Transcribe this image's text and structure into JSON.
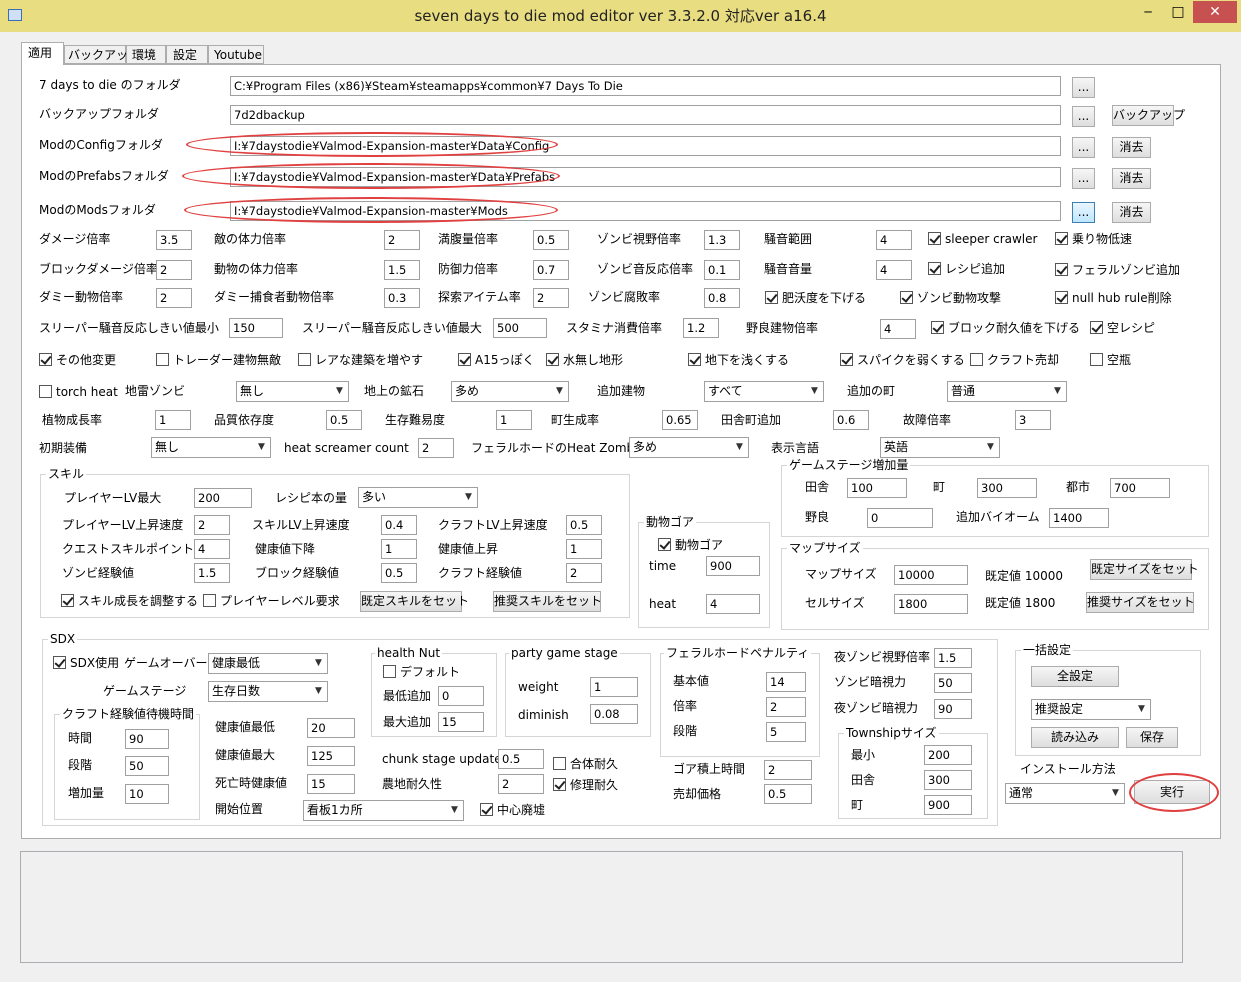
{
  "window": {
    "title": "seven days to die mod editor ver 3.3.2.0 対応ver a16.4",
    "minimize": "─",
    "maximize": "□",
    "close": "✕"
  },
  "tabs": [
    "適用",
    "バックアップ",
    "環境",
    "設定",
    "Youtube"
  ],
  "folders": {
    "game_label": "7 days to die のフォルダ",
    "game_value": "C:¥Program Files (x86)¥Steam¥steamapps¥common¥7 Days To Die",
    "backup_label": "バックアップフォルダ",
    "backup_value": "7d2dbackup",
    "config_label": "ModのConfigフォルダ",
    "config_value": "I:¥7daystodie¥Valmod-Expansion-master¥Data¥Config",
    "prefabs_label": "ModのPrefabsフォルダ",
    "prefabs_value": "I:¥7daystodie¥Valmod-Expansion-master¥Data¥Prefabs",
    "mods_label": "ModのModsフォルダ",
    "mods_value": "I:¥7daystodie¥Valmod-Expansion-master¥Mods",
    "browse": "...",
    "backup_btn": "バックアップ",
    "clear_btn": "消去"
  },
  "row1": {
    "l1": "ダメージ倍率",
    "v1": "3.5",
    "l2": "敵の体力倍率",
    "v2": "2",
    "l3": "満腹量倍率",
    "v3": "0.5",
    "l4": "ゾンビ視野倍率",
    "v4": "1.3",
    "l5": "騒音範囲",
    "v5": "4",
    "c1": "sleeper crawler",
    "c2": "乗り物低速"
  },
  "row2": {
    "l1": "ブロックダメージ倍率",
    "v1": "2",
    "l2": "動物の体力倍率",
    "v2": "1.5",
    "l3": "防御力倍率",
    "v3": "0.7",
    "l4": "ゾンビ音反応倍率",
    "v4": "0.1",
    "l5": "騒音音量",
    "v5": "4",
    "c1": "レシピ追加",
    "c2": "フェラルゾンビ追加"
  },
  "row3": {
    "l1": "ダミー動物倍率",
    "v1": "2",
    "l2": "ダミー捕食者動物倍率",
    "v2": "0.3",
    "l3": "探索アイテム率",
    "v3": "2",
    "l4": "ゾンビ腐敗率",
    "v4": "0.8",
    "c1": "肥沃度を下げる",
    "c2": "ゾンビ動物攻撃",
    "c3": "null hub rule削除"
  },
  "row4": {
    "l1": "スリーパー騒音反応しきい値最小",
    "v1": "150",
    "l2": "スリーパー騒音反応しきい値最大",
    "v2": "500",
    "l3": "スタミナ消費倍率",
    "v3": "1.2",
    "l4": "野良建物倍率",
    "v4": "4",
    "c1": "ブロック耐久値を下げる",
    "c2": "空レシピ"
  },
  "row5": {
    "c1": "その他変更",
    "c2": "トレーダー建物無敵",
    "c3": "レアな建築を増やす",
    "c4": "A15っぽく",
    "c5": "水無し地形",
    "c6": "地下を浅くする",
    "c7": "スパイクを弱くする",
    "c8": "クラフト売却",
    "c9": "空瓶"
  },
  "row6": {
    "c1": "torch heat",
    "l1": "地雷ゾンビ",
    "d1": "無し",
    "l2": "地上の鉱石",
    "d2": "多め",
    "l3": "追加建物",
    "d3": "すべて",
    "l4": "追加の町",
    "d4": "普通"
  },
  "row7": {
    "l1": "植物成長率",
    "v1": "1",
    "l2": "品質依存度",
    "v2": "0.5",
    "l3": "生存難易度",
    "v3": "1",
    "l4": "町生成率",
    "v4": "0.65",
    "l5": "田舎町追加",
    "v5": "0.6",
    "l6": "故障倍率",
    "v6": "3"
  },
  "row8": {
    "l1": "初期装備",
    "d1": "無し",
    "l2": "heat screamer count",
    "v2": "2",
    "l3": "フェラルホードのHeat Zombie量",
    "d3": "多め",
    "l4": "表示言語",
    "d4": "英語"
  },
  "skill": {
    "title": "スキル",
    "l1": "プレイヤーLV最大",
    "v1": "200",
    "l2": "レシピ本の量",
    "d2": "多い",
    "l3": "プレイヤーLV上昇速度",
    "v3": "2",
    "l4": "スキルLV上昇速度",
    "v4": "0.4",
    "l5": "クラフトLV上昇速度",
    "v5": "0.5",
    "l6": "クエストスキルポイント",
    "v6": "4",
    "l7": "健康値下降",
    "v7": "1",
    "l8": "健康値上昇",
    "v8": "1",
    "l9": "ゾンビ経験値",
    "v9": "1.5",
    "l10": "ブロック経験値",
    "v10": "0.5",
    "l11": "クラフト経験値",
    "v11": "2",
    "c1": "スキル成長を調整する",
    "c2": "プレイヤーレベル要求",
    "b1": "既定スキルをセット",
    "b2": "推奨スキルをセット"
  },
  "gore": {
    "title": "動物ゴア",
    "c1": "動物ゴア",
    "l1": "time",
    "v1": "900",
    "l2": "heat",
    "v2": "4"
  },
  "gamestage": {
    "title": "ゲームステージ増加量",
    "l1": "田舎",
    "v1": "100",
    "l2": "町",
    "v2": "300",
    "l3": "都市",
    "v3": "700",
    "l4": "野良",
    "v4": "0",
    "l5": "追加バイオーム",
    "v5": "1400"
  },
  "mapsize": {
    "title": "マップサイズ",
    "l1": "マップサイズ",
    "v1": "10000",
    "n1": "既定値 10000",
    "b1": "既定サイズをセット",
    "l2": "セルサイズ",
    "v2": "1800",
    "n2": "既定値 1800",
    "b2": "推奨サイズをセット"
  },
  "sdx": {
    "title": "SDX",
    "c1": "SDX使用",
    "l1": "ゲームオーバー",
    "d1": "健康最低",
    "l2": "ゲームステージ",
    "d2": "生存日数",
    "craft_title": "クラフト経験値待機時間",
    "cl1": "時間",
    "cv1": "90",
    "cl2": "段階",
    "cv2": "50",
    "cl3": "増加量",
    "cv3": "10",
    "l3": "健康値最低",
    "v3": "20",
    "l4": "健康値最大",
    "v4": "125",
    "l5": "死亡時健康値",
    "v5": "15",
    "l6": "開始位置",
    "d6": "看板1カ所",
    "c2": "中心廃墟",
    "hn_title": "health Nut",
    "hn_c": "デフォルト",
    "hn_l1": "最低追加",
    "hn_v1": "0",
    "hn_l2": "最大追加",
    "hn_v2": "15",
    "pg_title": "party game stage",
    "pg_l1": "weight",
    "pg_v1": "1",
    "pg_l2": "diminish",
    "pg_v2": "0.08",
    "l7": "chunk stage update",
    "v7": "0.5",
    "c3": "合体耐久",
    "l8": "農地耐久性",
    "v8": "2",
    "c4": "修理耐久",
    "fh_title": "フェラルホードペナルティ",
    "fh_l1": "基本値",
    "fh_v1": "14",
    "fh_l2": "倍率",
    "fh_v2": "2",
    "fh_l3": "段階",
    "fh_v3": "5",
    "l9": "ゴア積上時間",
    "v9": "2",
    "l10": "売却価格",
    "v10": "0.5",
    "l11": "夜ゾンビ視野倍率",
    "v11": "1.5",
    "l12": "ゾンビ暗視力",
    "v12": "50",
    "l13": "夜ゾンビ暗視力",
    "v13": "90",
    "ts_title": "Townshipサイズ",
    "ts_l1": "最小",
    "ts_v1": "200",
    "ts_l2": "田舎",
    "ts_v2": "300",
    "ts_l3": "町",
    "ts_v3": "900"
  },
  "bulk": {
    "title": "一括設定",
    "b1": "全設定",
    "d1": "推奨設定",
    "b2": "読み込み",
    "b3": "保存"
  },
  "install": {
    "label": "インストール方法",
    "d1": "通常",
    "run": "実行"
  },
  "colors": {
    "annotation": "#e04040",
    "accent": "#3c7fb1"
  }
}
